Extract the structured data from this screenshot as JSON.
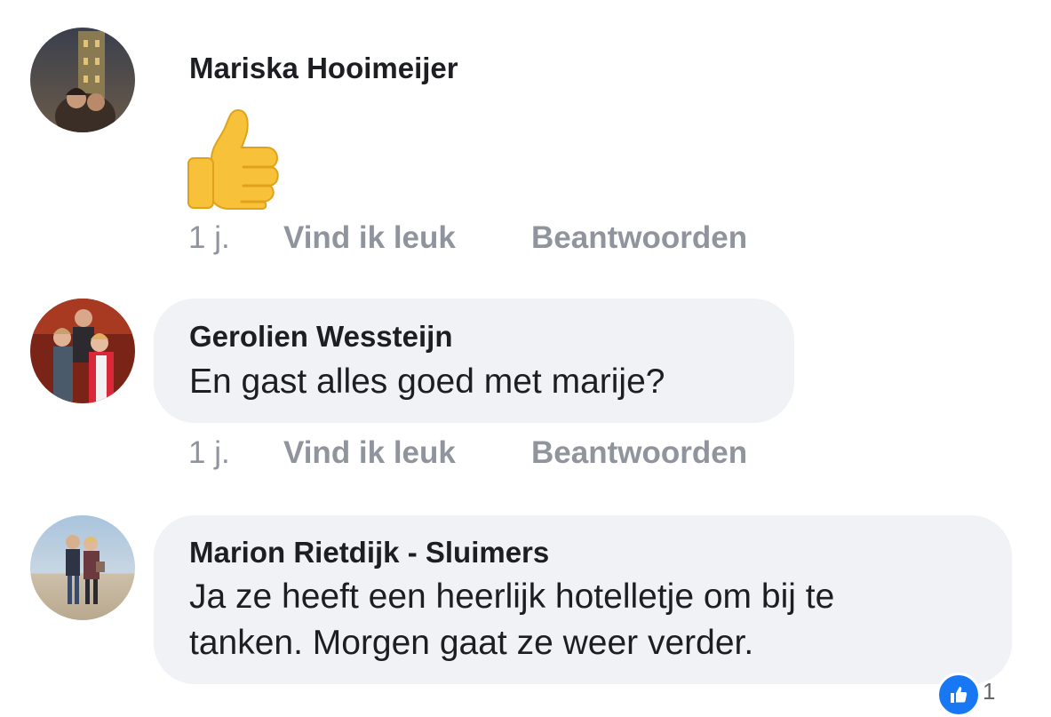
{
  "comments": [
    {
      "author": "Mariska Hooimeijer",
      "content_icon": "thumbs-up-emoji",
      "time": "1 j.",
      "like_label": "Vind ik leuk",
      "reply_label": "Beantwoorden"
    },
    {
      "author": "Gerolien Wessteijn",
      "lines": [
        "En gast alles goed met marije?"
      ],
      "time": "1 j.",
      "like_label": "Vind ik leuk",
      "reply_label": "Beantwoorden"
    },
    {
      "author": "Marion Rietdijk - Sluimers",
      "lines": [
        "Ja ze heeft een heerlijk hotelletje om bij te",
        "tanken. Morgen gaat ze weer verder."
      ],
      "reaction_icon": "like-icon",
      "reaction_count": "1"
    }
  ],
  "colors": {
    "bubble": "#f0f2f5",
    "meta_text": "#90949c",
    "like_blue": "#1877f2"
  }
}
